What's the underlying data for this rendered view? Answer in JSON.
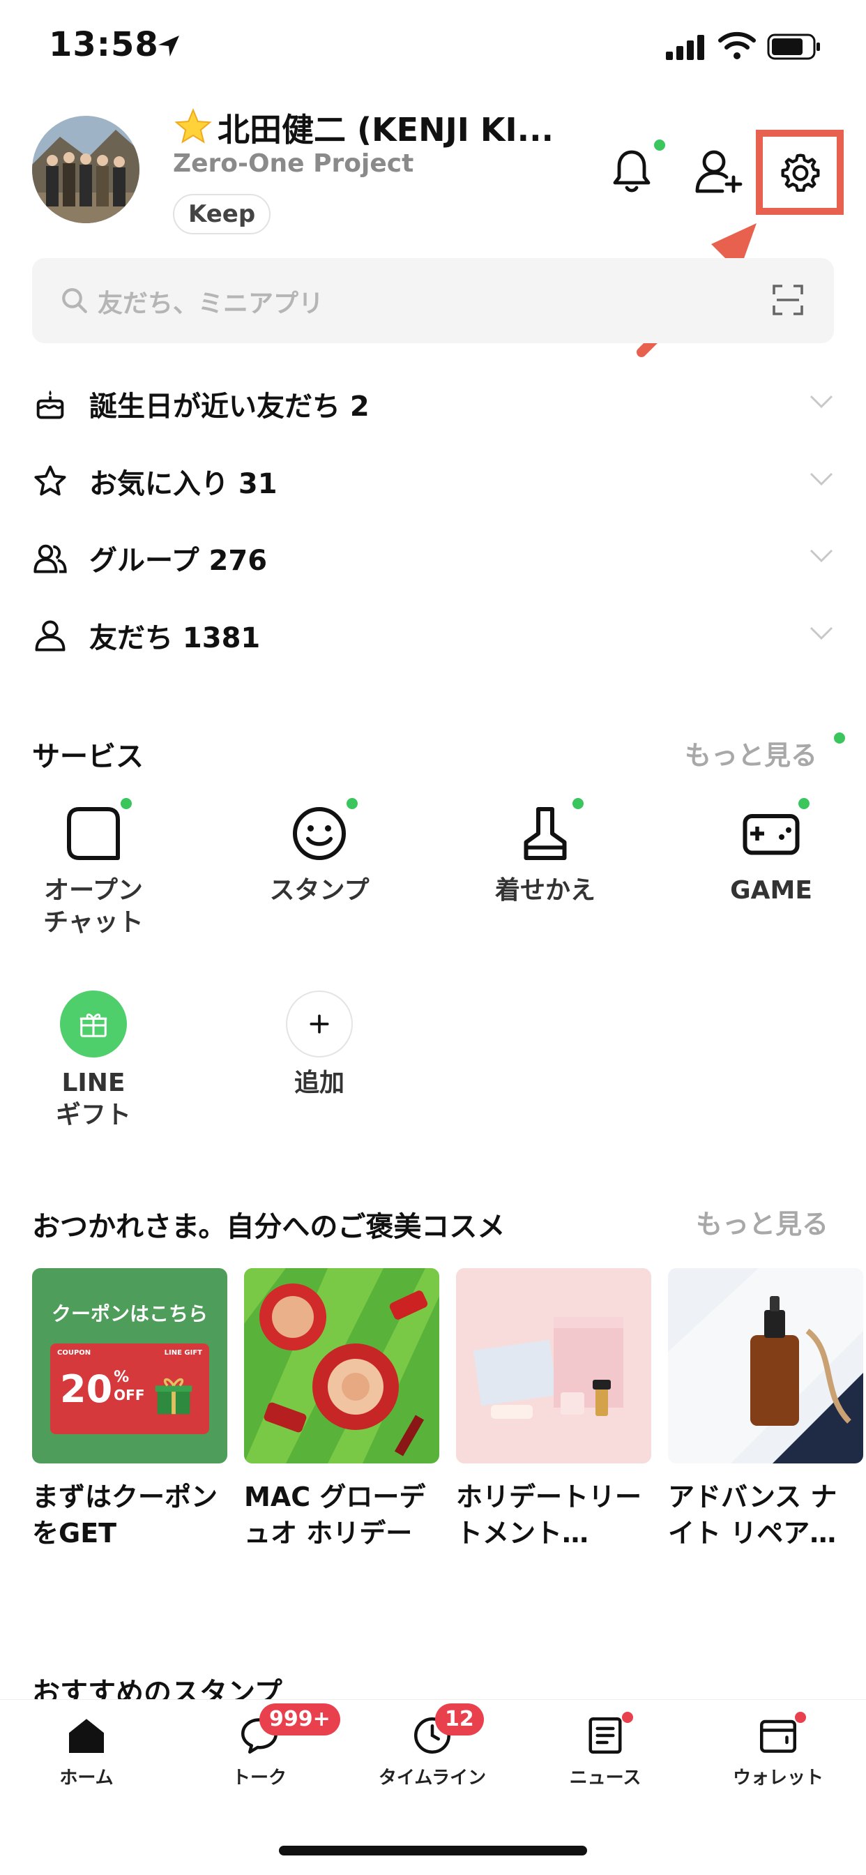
{
  "status_bar": {
    "time": "13:58"
  },
  "profile": {
    "name": "北田健二 (KENJI KI...",
    "status_message": "Zero-One Project",
    "keep_label": "Keep"
  },
  "search": {
    "placeholder": "友だち、ミニアプリ"
  },
  "friend_rows": [
    {
      "label": "誕生日が近い友だち 2",
      "icon": "cake-icon"
    },
    {
      "label": "お気に入り 31",
      "icon": "star-icon"
    },
    {
      "label": "グループ 276",
      "icon": "group-icon"
    },
    {
      "label": "友だち 1381",
      "icon": "person-icon"
    }
  ],
  "services": {
    "title": "サービス",
    "more": "もっと見る",
    "items": [
      {
        "label": "オープン\nチャット",
        "icon": "open-chat-icon"
      },
      {
        "label": "スタンプ",
        "icon": "sticker-smile-icon"
      },
      {
        "label": "着せかえ",
        "icon": "theme-brush-icon"
      },
      {
        "label": "GAME",
        "icon": "game-controller-icon"
      },
      {
        "label": "LINE\nギフト",
        "icon": "gift-icon"
      },
      {
        "label": "追加",
        "icon": "plus-icon"
      }
    ]
  },
  "cosmetics": {
    "title": "おつかれさま。自分へのご褒美コスメ",
    "more": "もっと見る",
    "coupon_banner": {
      "headline": "クーポンはこちら",
      "coupon_word": "COUPON",
      "brand": "LINE GIFT",
      "discount": "20",
      "percent": "%",
      "off": "OFF"
    },
    "cards": [
      {
        "title": "まずはクーポンをGET"
      },
      {
        "title": "MAC グローデュオ ホリデー"
      },
      {
        "title": "ホリデートリートメント…"
      },
      {
        "title": "アドバンス ナイト リペア…"
      }
    ]
  },
  "stickers_section": {
    "title": "おすすめのスタンプ"
  },
  "tabbar": {
    "items": [
      {
        "label": "ホーム",
        "icon": "home-icon"
      },
      {
        "label": "トーク",
        "icon": "chat-bubble-icon",
        "badge": "999+"
      },
      {
        "label": "タイムライン",
        "icon": "clock-icon",
        "badge": "12"
      },
      {
        "label": "ニュース",
        "icon": "news-icon"
      },
      {
        "label": "ウォレット",
        "icon": "wallet-icon"
      }
    ]
  },
  "colors": {
    "accent_green": "#3ac55d",
    "badge_red": "#e9404e",
    "highlight_red": "#e8614f"
  }
}
